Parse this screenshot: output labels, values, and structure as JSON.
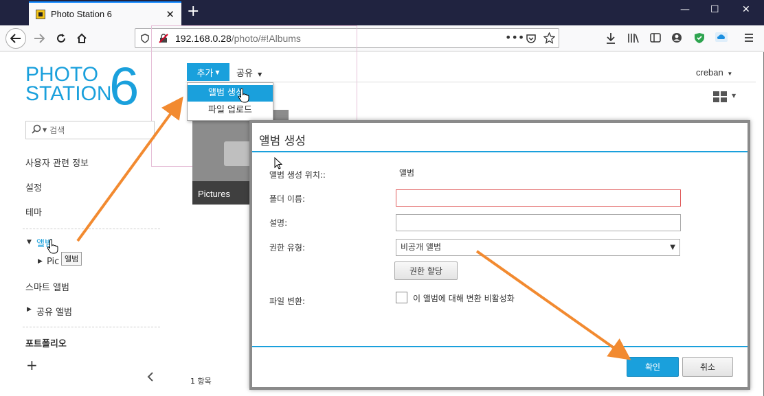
{
  "browser": {
    "tab_title": "Photo Station 6",
    "tab_close": "✕",
    "new_tab": "+",
    "window_controls": {
      "minimize": "—",
      "maximize": "☐",
      "close": "✕"
    },
    "url_host": "192.168.0.28",
    "url_path": "/photo/#!Albums"
  },
  "logo": {
    "line1": "PHOTO",
    "line2": "STATION",
    "number": "6"
  },
  "search": {
    "placeholder": "검색"
  },
  "sidebar": {
    "items": [
      {
        "label": "사용자 관련 정보"
      },
      {
        "label": "설정"
      },
      {
        "label": "테마"
      }
    ],
    "albums_label": "앨범",
    "albums_child": "Pic",
    "tooltip": "앨범",
    "smart_album": "스마트 앨범",
    "shared_album": "공유 앨범",
    "portfolio": "포트폴리오",
    "add_symbol": "+"
  },
  "toolbar": {
    "add_label": "추가",
    "share_label": "공유",
    "user": "creban"
  },
  "add_menu": {
    "items": [
      {
        "label": "앨범 생성"
      },
      {
        "label": "파일 업로드"
      }
    ]
  },
  "album_tile": {
    "label": "Pictures"
  },
  "footer": {
    "count": "1 항목"
  },
  "dialog": {
    "title": "앨범 생성",
    "location_label": "앨범 생성 위치::",
    "location_value": "앨범",
    "folder_label": "폴더 이름:",
    "folder_value": "",
    "desc_label": "설명:",
    "desc_value": "",
    "perm_type_label": "권한 유형:",
    "perm_type_value": "비공개 앨범",
    "assign_perm_button": "권한 할당",
    "file_convert_label": "파일 변환:",
    "disable_convert_label": "이 앨범에 대해 변환 비활성화",
    "ok_button": "확인",
    "cancel_button": "취소"
  },
  "colors": {
    "accent": "#1aa0dc",
    "annotation": "#f28a30",
    "tabbar": "#202340"
  }
}
